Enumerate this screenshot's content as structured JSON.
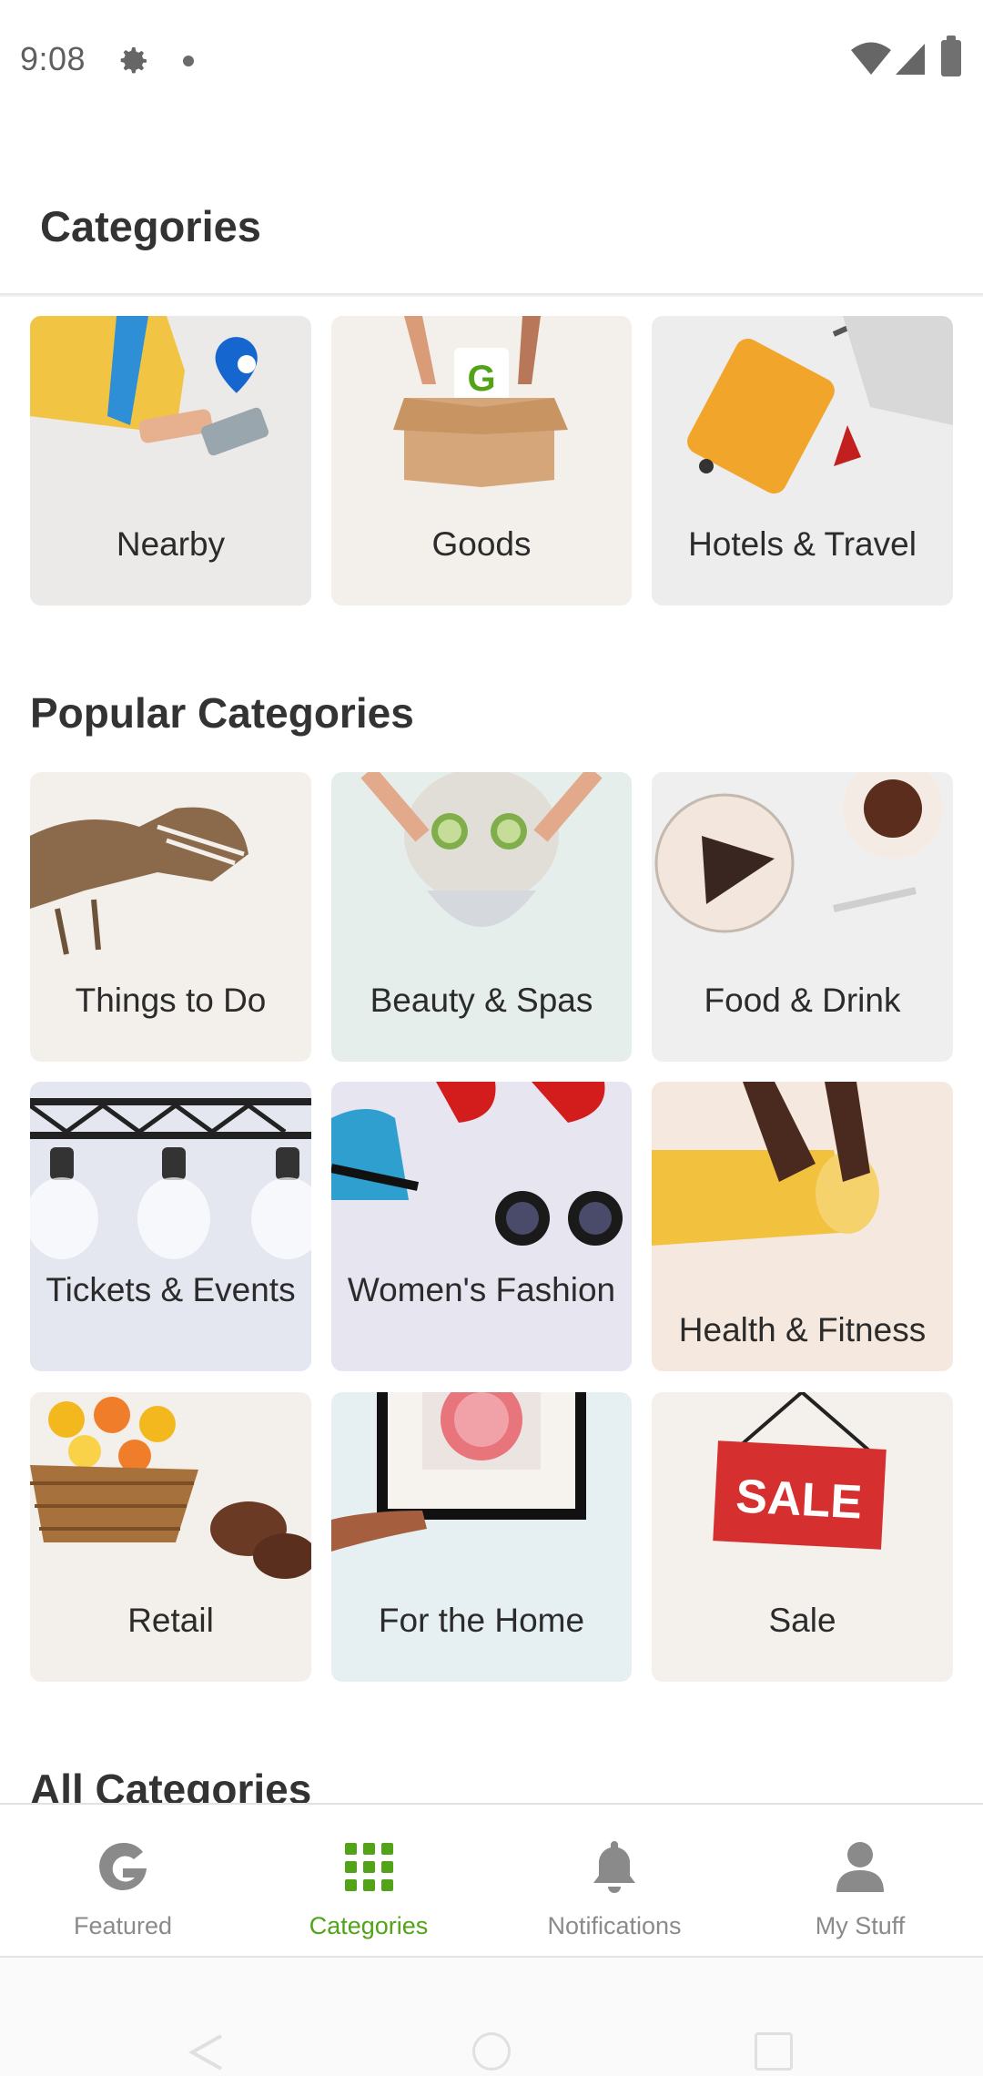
{
  "status_bar": {
    "time": "9:08"
  },
  "header": {
    "title": "Categories"
  },
  "top_tiles": [
    {
      "label": "Nearby",
      "icon": "location-pin-icon"
    },
    {
      "label": "Goods",
      "icon": "box-icon"
    },
    {
      "label": "Hotels & Travel",
      "icon": "suitcase-icon"
    }
  ],
  "popular": {
    "title": "Popular Categories",
    "tiles": [
      {
        "label": "Things to Do"
      },
      {
        "label": "Beauty & Spas"
      },
      {
        "label": "Food & Drink"
      },
      {
        "label": "Tickets & Events"
      },
      {
        "label": "Women's Fashion"
      },
      {
        "label": "Health & Fitness"
      },
      {
        "label": "Retail"
      },
      {
        "label": "For the Home"
      },
      {
        "label": "Sale",
        "sign_text": "SALE"
      }
    ]
  },
  "all": {
    "title": "All Categories"
  },
  "goods_logo": "G",
  "bottom_nav": {
    "items": [
      {
        "label": "Featured",
        "icon": "groupon-g-icon",
        "active": false
      },
      {
        "label": "Categories",
        "icon": "grid-icon",
        "active": true
      },
      {
        "label": "Notifications",
        "icon": "bell-icon",
        "active": false
      },
      {
        "label": "My Stuff",
        "icon": "person-icon",
        "active": false
      }
    ]
  },
  "colors": {
    "accent": "#53a318",
    "inactive": "#8a8a8a",
    "sale_red": "#d62f2f"
  }
}
